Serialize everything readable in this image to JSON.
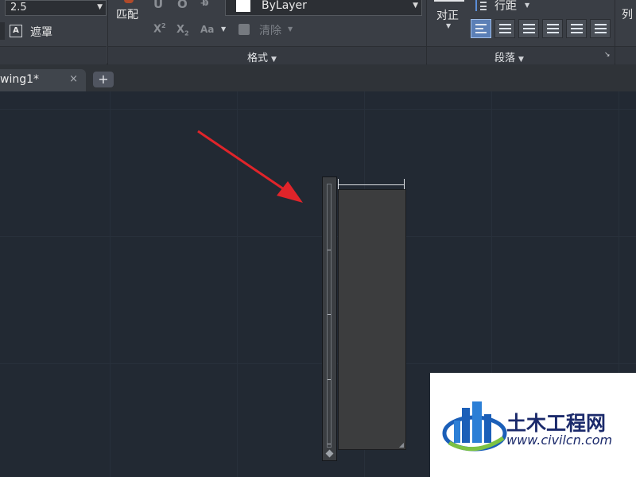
{
  "ribbon": {
    "text_height_value": "2.5",
    "mask_label": "遮罩",
    "match_label": "匹配",
    "color_value": "ByLayer",
    "clear_label": "清除",
    "aa_label": "Aa",
    "format_panel_title": "格式",
    "justify_label": "对正",
    "line_spacing_label": "行距",
    "paragraph_panel_title": "段落",
    "right_cut_label": "列"
  },
  "tabs": {
    "drawing_tab_label": "wing1*",
    "close_symbol": "×",
    "new_tab_symbol": "+"
  },
  "watermark": {
    "name": "土木工程网",
    "url": "www.civilcn.com"
  },
  "colors": {
    "canvas_bg": "#222933",
    "ribbon_bg": "#3a3e45",
    "arrow": "#e0242a",
    "active_align": "#5b7fb6",
    "watermark_text": "#1b2a6b"
  }
}
